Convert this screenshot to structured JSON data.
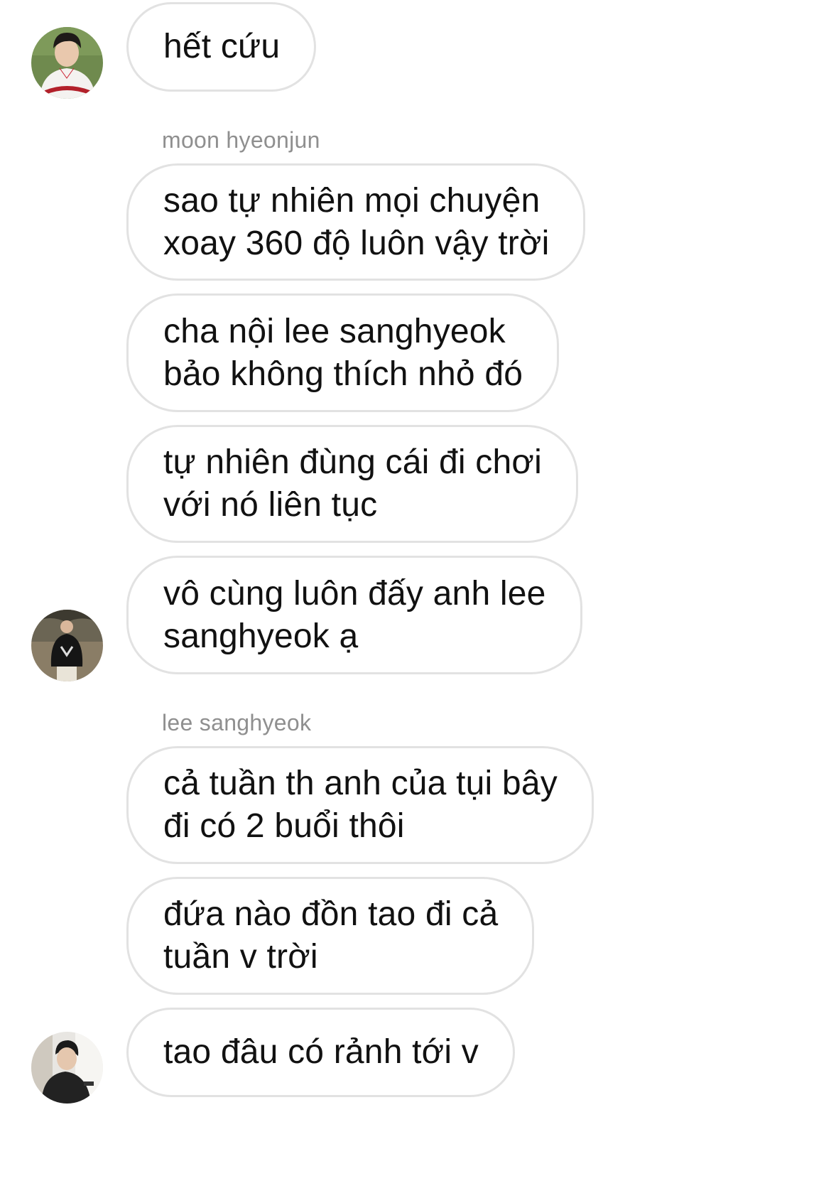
{
  "messages": [
    {
      "text": "hết cứu"
    },
    {
      "sender": "moon hyeonjun"
    },
    {
      "text": "sao tự nhiên mọi chuyện\nxoay 360 độ luôn vậy trời"
    },
    {
      "text": "cha nội lee sanghyeok\nbảo không thích nhỏ đó"
    },
    {
      "text": "tự nhiên đùng cái đi chơi\nvới nó liên tục"
    },
    {
      "text": "vô cùng luôn đấy anh lee\nsanghyeok ạ"
    },
    {
      "sender": "lee sanghyeok"
    },
    {
      "text": "cả tuần th anh của tụi bây\nđi có 2 buổi thôi"
    },
    {
      "text": "đứa nào đồn tao đi cả\ntuần v trời"
    },
    {
      "text": "tao đâu có rảnh tới v"
    }
  ],
  "avatars": [
    {
      "icon": "baseball-jersey-user-avatar"
    },
    {
      "icon": "black-hoodie-user-avatar"
    },
    {
      "icon": "dark-jacket-user-avatar"
    }
  ],
  "colors": {
    "bubble_border": "#e2e2e2",
    "sender_label": "#8f8f8f",
    "text": "#111111"
  }
}
